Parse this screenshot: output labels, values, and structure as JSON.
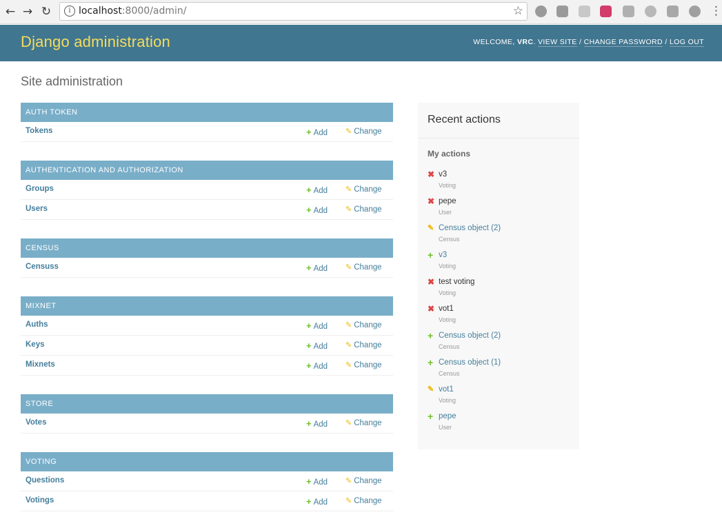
{
  "browser": {
    "url_host": "localhost",
    "url_rest": ":8000/admin/",
    "extensions": [
      "ext-icon-1",
      "ext-icon-2",
      "ext-icon-3",
      "ext-icon-4",
      "ext-icon-5",
      "ext-icon-6",
      "ext-icon-7",
      "ext-icon-8"
    ]
  },
  "header": {
    "branding": "Django administration",
    "welcome": "WELCOME, ",
    "username": "VRC",
    "welcome_end": ". ",
    "view_site": "VIEW SITE",
    "sep1": " / ",
    "change_password": "CHANGE PASSWORD",
    "sep2": " / ",
    "log_out": "LOG OUT"
  },
  "page_title": "Site administration",
  "add_label": "Add",
  "change_label": "Change",
  "modules": [
    {
      "caption": "AUTH TOKEN",
      "models": [
        "Tokens"
      ]
    },
    {
      "caption": "AUTHENTICATION AND AUTHORIZATION",
      "models": [
        "Groups",
        "Users"
      ]
    },
    {
      "caption": "CENSUS",
      "models": [
        "Censuss"
      ]
    },
    {
      "caption": "MIXNET",
      "models": [
        "Auths",
        "Keys",
        "Mixnets"
      ]
    },
    {
      "caption": "STORE",
      "models": [
        "Votes"
      ]
    },
    {
      "caption": "VOTING",
      "models": [
        "Questions",
        "Votings"
      ]
    }
  ],
  "recent": {
    "title": "Recent actions",
    "subtitle": "My actions",
    "actions": [
      {
        "kind": "delete",
        "object": "v3",
        "type": "Voting"
      },
      {
        "kind": "delete",
        "object": "pepe",
        "type": "User"
      },
      {
        "kind": "change",
        "object": "Census object (2)",
        "type": "Census"
      },
      {
        "kind": "add",
        "object": "v3",
        "type": "Voting"
      },
      {
        "kind": "delete",
        "object": "test voting",
        "type": "Voting"
      },
      {
        "kind": "delete",
        "object": "vot1",
        "type": "Voting"
      },
      {
        "kind": "add",
        "object": "Census object (2)",
        "type": "Census"
      },
      {
        "kind": "add",
        "object": "Census object (1)",
        "type": "Census"
      },
      {
        "kind": "change",
        "object": "vot1",
        "type": "Voting"
      },
      {
        "kind": "add",
        "object": "pepe",
        "type": "User"
      }
    ]
  },
  "colors": {
    "header_bg": "#417690",
    "branding": "#f5dd5d",
    "caption_bg": "#79aec8",
    "link": "#447e9b",
    "add_green": "#70bf2b",
    "change_yellow": "#efb80b",
    "delete_red": "#dd4646"
  }
}
